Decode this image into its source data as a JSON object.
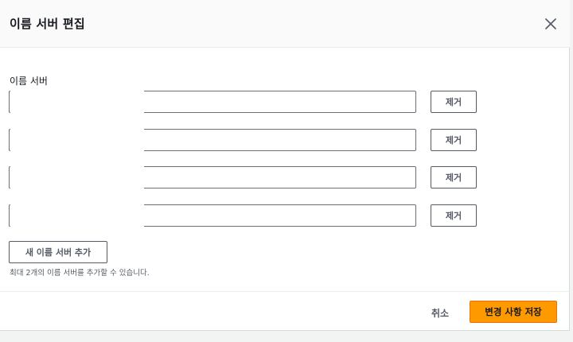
{
  "modal": {
    "title": "이름 서버 편집",
    "close_icon": "close-icon"
  },
  "nameservers": {
    "label": "이름 서버",
    "rows": [
      {
        "value": "",
        "remove_label": "제거"
      },
      {
        "value": "",
        "remove_label": "제거"
      },
      {
        "value": "",
        "remove_label": "제거"
      },
      {
        "value": "",
        "remove_label": "제거"
      }
    ],
    "add_label": "새 이름 서버 추가",
    "hint": "최대 2개의 이름 서버를 추가할 수 있습니다."
  },
  "footer": {
    "cancel_label": "취소",
    "save_label": "변경 사항 저장"
  },
  "colors": {
    "primary": "#ff9900",
    "primary_border": "#ec7211",
    "text": "#16191f",
    "secondary_text": "#545b64"
  }
}
